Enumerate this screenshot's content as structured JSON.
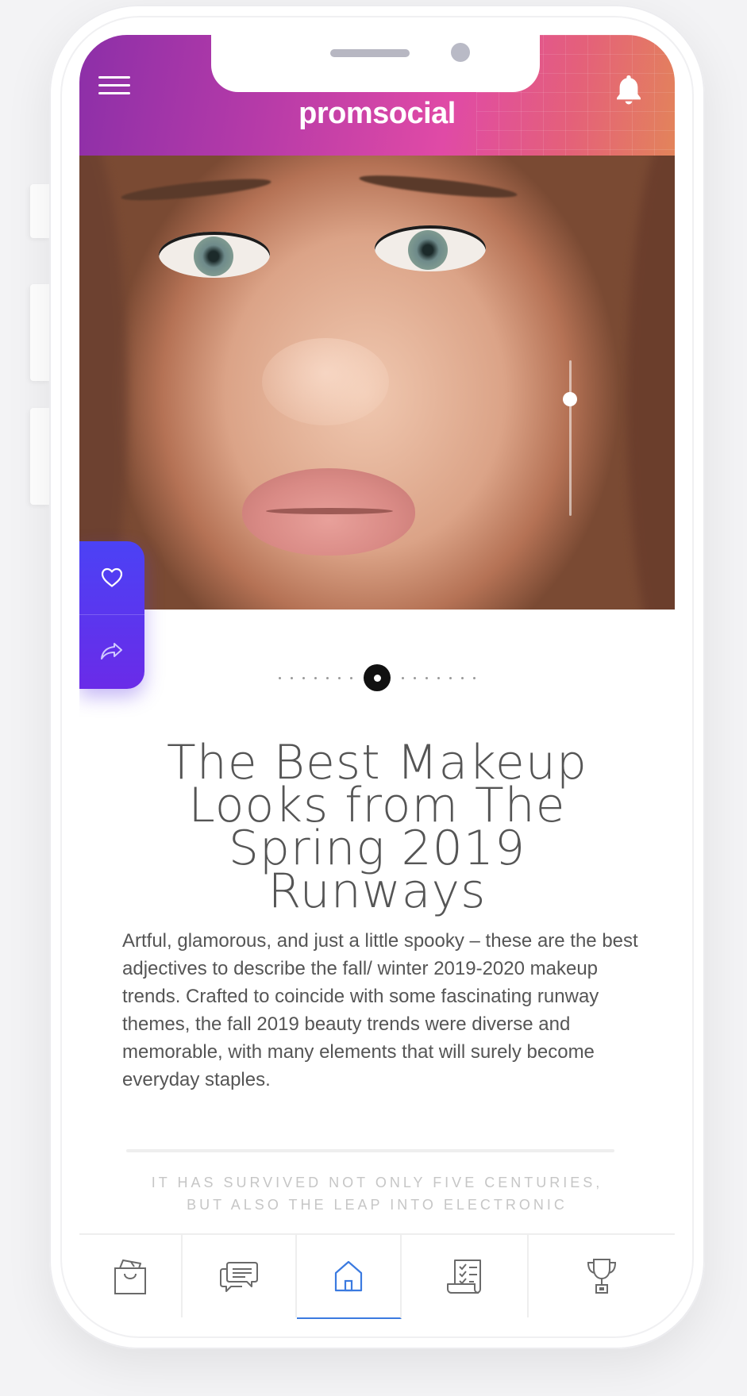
{
  "app": {
    "logo_text": "promsocial"
  },
  "header": {
    "menu_icon": "hamburger-menu-icon",
    "notification_icon": "bell-icon"
  },
  "hero": {
    "image_description_icon": "model-face-photo",
    "slider_value": 0.25
  },
  "actions": {
    "like_icon": "heart-icon",
    "share_icon": "share-arrow-icon"
  },
  "pager": {
    "total": 15,
    "active_index": 7
  },
  "article": {
    "title_line1": "The Best Makeup",
    "title_line2": "Looks from The",
    "title_line3": "Spring 2019 Runways",
    "body": "Artful, glamorous, and just a little spooky – these are the best adjectives to describe the fall/ winter 2019-2020 makeup trends. Crafted to coincide with some fascinating runway themes, the fall 2019 beauty trends were diverse and memorable, with many elements that will surely become everyday staples.",
    "quote_line1": "IT HAS SURVIVED NOT ONLY FIVE CENTURIES,",
    "quote_line2": "BUT ALSO THE LEAP INTO ELECTRONIC"
  },
  "tabbar": {
    "tabs": [
      {
        "icon": "shopping-bag-icon",
        "active": false
      },
      {
        "icon": "chat-bubbles-icon",
        "active": false
      },
      {
        "icon": "home-icon",
        "active": true
      },
      {
        "icon": "checklist-icon",
        "active": false
      },
      {
        "icon": "trophy-icon",
        "active": false
      }
    ]
  },
  "colors": {
    "accent_blue": "#3b7ae0",
    "action_gradient_top": "#4b42f5",
    "action_gradient_bottom": "#6a2be8",
    "header_gradient_start": "#8c2fa8",
    "header_gradient_end": "#e3845a"
  }
}
